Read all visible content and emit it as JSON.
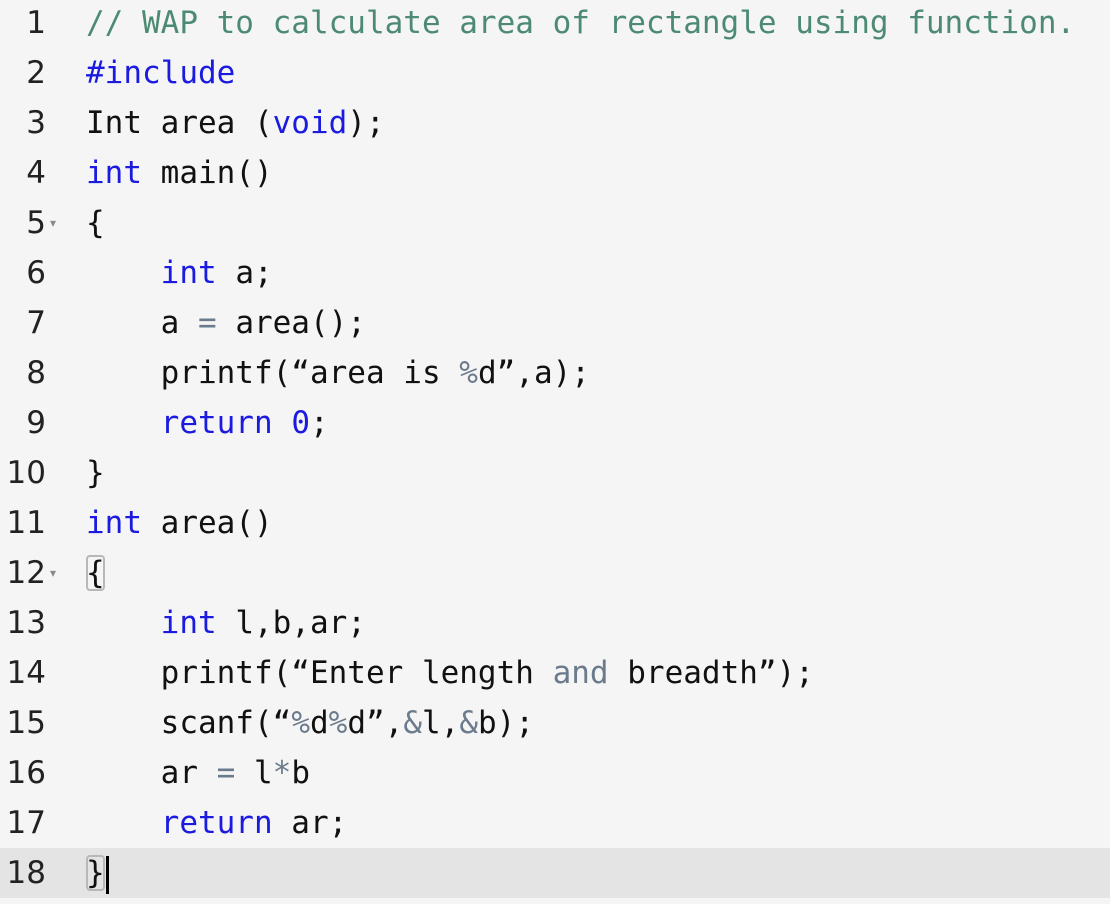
{
  "editor": {
    "fold_icon": "fold-arrow-icon",
    "colors": {
      "background": "#f5f5f5",
      "active_line": "#e4e4e4",
      "comment": "#4d8a73",
      "keyword": "#1a1ae0",
      "operator": "#6b7b8c",
      "text": "#111111"
    },
    "cursor": {
      "line": 18
    },
    "lines": [
      {
        "n": "1",
        "tokens": [
          {
            "t": "// WAP to calculate area of rectangle using function.",
            "c": "comment"
          }
        ]
      },
      {
        "n": "2",
        "tokens": [
          {
            "t": "#include",
            "c": "kw"
          }
        ]
      },
      {
        "n": "3",
        "tokens": [
          {
            "t": "Int area (",
            "c": "plain"
          },
          {
            "t": "void",
            "c": "kw"
          },
          {
            "t": ");",
            "c": "plain"
          }
        ]
      },
      {
        "n": "4",
        "tokens": [
          {
            "t": "int",
            "c": "kw"
          },
          {
            "t": " main()",
            "c": "plain"
          }
        ]
      },
      {
        "n": "5",
        "fold": true,
        "tokens": [
          {
            "t": "{",
            "c": "plain"
          }
        ]
      },
      {
        "n": "6",
        "tokens": [
          {
            "t": "    ",
            "c": "plain"
          },
          {
            "t": "int",
            "c": "kw"
          },
          {
            "t": " a;",
            "c": "plain"
          }
        ]
      },
      {
        "n": "7",
        "tokens": [
          {
            "t": "    a ",
            "c": "plain"
          },
          {
            "t": "=",
            "c": "op"
          },
          {
            "t": " area();",
            "c": "plain"
          }
        ]
      },
      {
        "n": "8",
        "tokens": [
          {
            "t": "    printf(“area is ",
            "c": "plain"
          },
          {
            "t": "%",
            "c": "op"
          },
          {
            "t": "d”,a);",
            "c": "plain"
          }
        ]
      },
      {
        "n": "9",
        "tokens": [
          {
            "t": "    ",
            "c": "plain"
          },
          {
            "t": "return",
            "c": "kw"
          },
          {
            "t": " ",
            "c": "plain"
          },
          {
            "t": "0",
            "c": "kw"
          },
          {
            "t": ";",
            "c": "plain"
          }
        ]
      },
      {
        "n": "10",
        "tokens": [
          {
            "t": "}",
            "c": "plain"
          }
        ]
      },
      {
        "n": "11",
        "tokens": [
          {
            "t": "int",
            "c": "kw"
          },
          {
            "t": " area()",
            "c": "plain"
          }
        ]
      },
      {
        "n": "12",
        "fold": true,
        "tokens": [
          {
            "t": "{",
            "c": "plain",
            "match": true
          }
        ]
      },
      {
        "n": "13",
        "tokens": [
          {
            "t": "    ",
            "c": "plain"
          },
          {
            "t": "int",
            "c": "kw"
          },
          {
            "t": " l,b,ar;",
            "c": "plain"
          }
        ]
      },
      {
        "n": "14",
        "tokens": [
          {
            "t": "    printf(“Enter length ",
            "c": "plain"
          },
          {
            "t": "and",
            "c": "op"
          },
          {
            "t": " breadth”);",
            "c": "plain"
          }
        ]
      },
      {
        "n": "15",
        "tokens": [
          {
            "t": "    scanf(“",
            "c": "plain"
          },
          {
            "t": "%",
            "c": "op"
          },
          {
            "t": "d",
            "c": "plain"
          },
          {
            "t": "%",
            "c": "op"
          },
          {
            "t": "d”,",
            "c": "plain"
          },
          {
            "t": "&",
            "c": "op"
          },
          {
            "t": "l,",
            "c": "plain"
          },
          {
            "t": "&",
            "c": "op"
          },
          {
            "t": "b);",
            "c": "plain"
          }
        ]
      },
      {
        "n": "16",
        "tokens": [
          {
            "t": "    ar ",
            "c": "plain"
          },
          {
            "t": "=",
            "c": "op"
          },
          {
            "t": " l",
            "c": "plain"
          },
          {
            "t": "*",
            "c": "op"
          },
          {
            "t": "b",
            "c": "plain"
          }
        ]
      },
      {
        "n": "17",
        "tokens": [
          {
            "t": "    ",
            "c": "plain"
          },
          {
            "t": "return",
            "c": "kw"
          },
          {
            "t": " ar;",
            "c": "plain"
          }
        ]
      },
      {
        "n": "18",
        "active": true,
        "tokens": [
          {
            "t": "}",
            "c": "plain",
            "match": true
          }
        ]
      }
    ]
  }
}
